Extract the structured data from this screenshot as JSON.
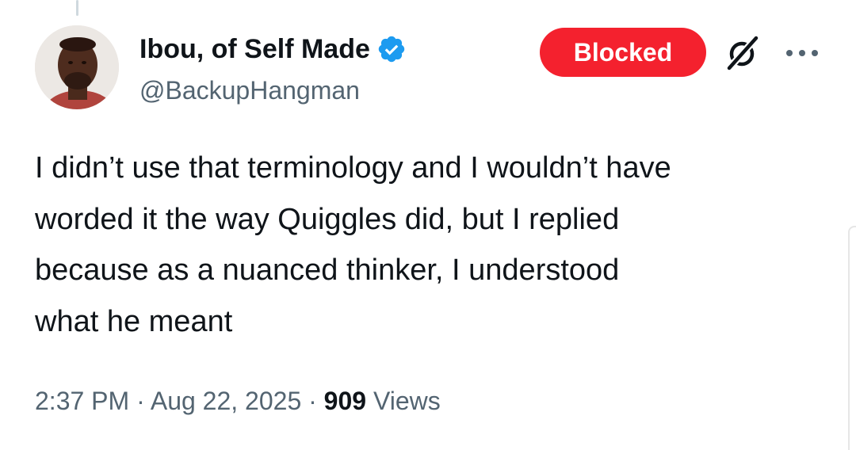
{
  "tweet": {
    "author": {
      "display_name": "Ibou, of Self Made",
      "handle": "@BackupHangman",
      "verified": true,
      "verified_color": "#1d9bf0"
    },
    "blocked_label": "Blocked",
    "text_lines": [
      "I didn’t use that terminology and I wouldn’t have",
      "worded it the way Quiggles did, but I replied",
      "because as a nuanced thinker, I understood",
      "what he meant"
    ],
    "time": "2:37 PM",
    "separator": "·",
    "date": "Aug 22, 2025",
    "views_count": "909",
    "views_label": "Views"
  },
  "icons": {
    "verified": "verified-badge-icon",
    "grok": "grok-icon",
    "more": "more-options-icon"
  },
  "colors": {
    "blocked_button": "#f4212e",
    "secondary_text": "#536471",
    "primary_text": "#0f1419"
  }
}
